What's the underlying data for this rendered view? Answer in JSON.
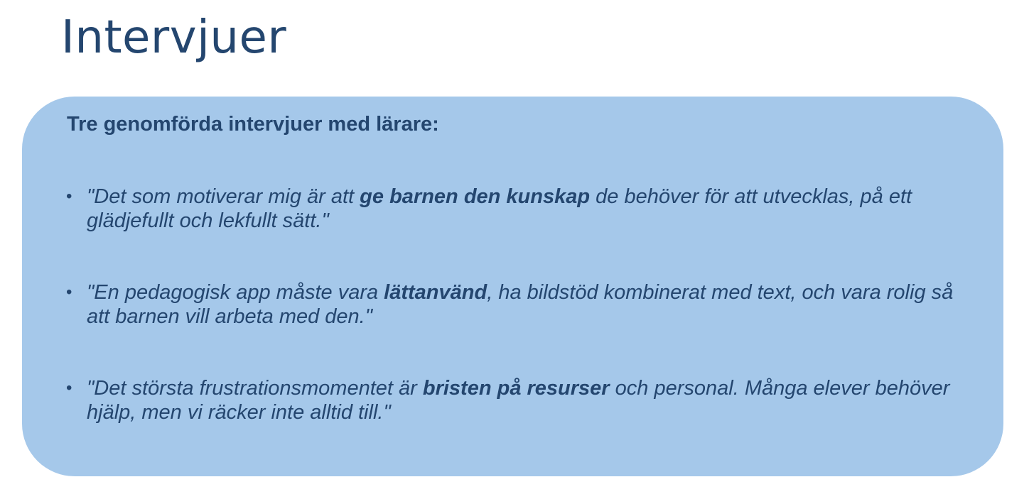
{
  "slide": {
    "title": "Intervjuer"
  },
  "box": {
    "intro": "Tre genomförda intervjuer med lärare:",
    "quotes": [
      {
        "before": "\"Det som motiverar mig är att ",
        "highlight": "ge barnen den kunskap",
        "after": " de behöver för att utvecklas, på ett glädjefullt och lekfullt sätt.\""
      },
      {
        "before": "\"En pedagogisk app måste vara ",
        "highlight": "lättanvänd",
        "after": ", ha bildstöd kombinerat med text, och vara rolig så att barnen vill arbeta med den.\""
      },
      {
        "before": "\"Det största frustrationsmomentet är ",
        "highlight": "bristen på resurser",
        "after": " och personal. Många elever behöver hjälp, men vi räcker inte alltid till.\""
      }
    ]
  },
  "colors": {
    "title_text": "#24466f",
    "box_background": "#a5c8ea",
    "page_background": "#ffffff"
  },
  "icons": {
    "bullet": "•"
  }
}
